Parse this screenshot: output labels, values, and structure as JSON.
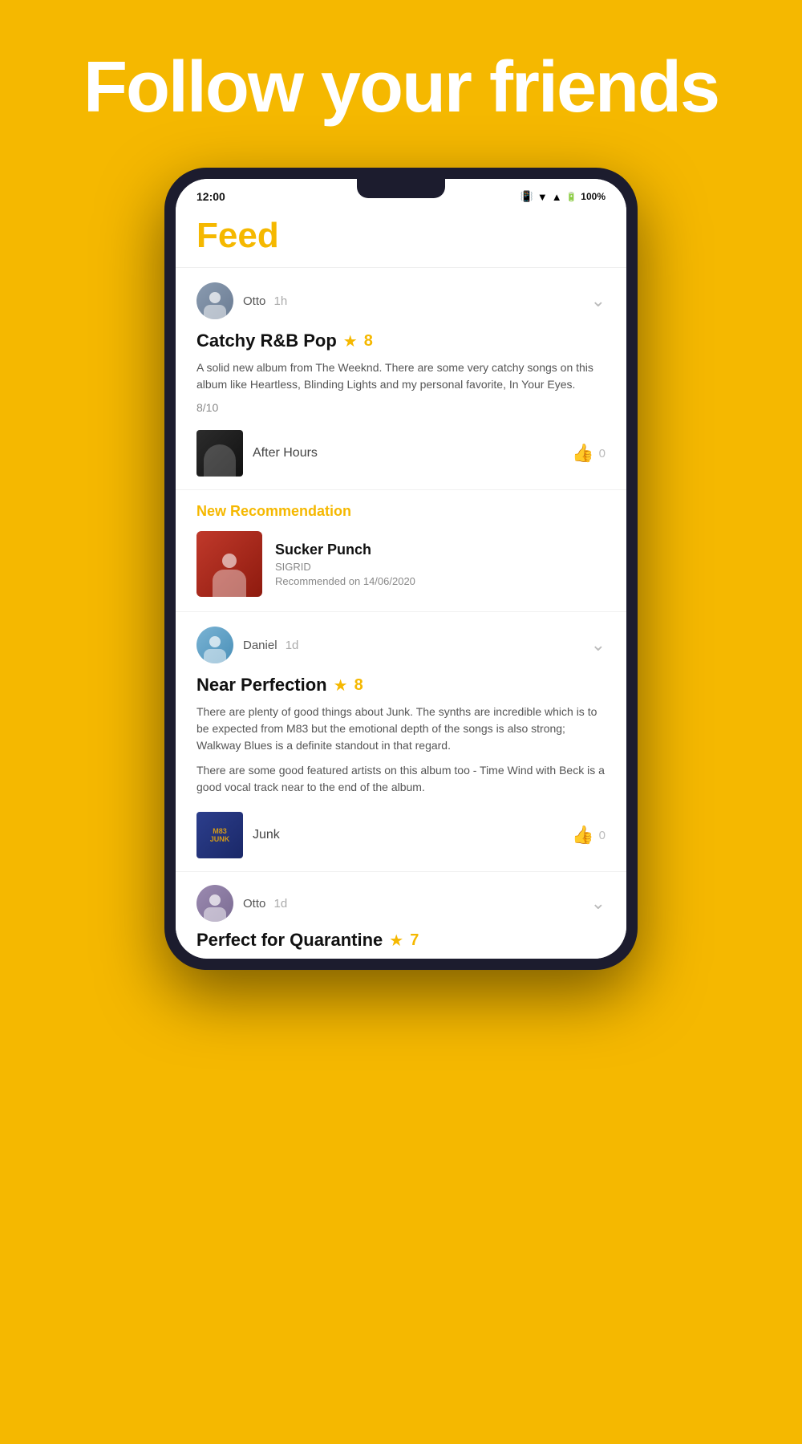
{
  "hero": {
    "title": "Follow your friends"
  },
  "status_bar": {
    "time": "12:00",
    "battery": "100%"
  },
  "app": {
    "title": "Feed"
  },
  "feed_items": [
    {
      "id": "review-1",
      "user": "Otto",
      "time_ago": "1h",
      "review_title": "Catchy R&B Pop",
      "score": "8",
      "review_text": "A solid new album from The Weeknd. There are some very catchy songs on this album like Heartless, Blinding Lights and my personal favorite, In Your Eyes.",
      "rating": "8/10",
      "album_name": "After Hours",
      "likes": "0"
    }
  ],
  "new_recommendation": {
    "label": "New Recommendation",
    "title": "Sucker Punch",
    "artist": "SIGRID",
    "date": "Recommended on 14/06/2020"
  },
  "feed_items_2": [
    {
      "id": "review-2",
      "user": "Daniel",
      "time_ago": "1d",
      "review_title": "Near Perfection",
      "score": "8",
      "review_text": "There are plenty of good things about Junk. The synths are incredible which is to be expected from M83 but the emotional depth of the songs is also strong; Walkway Blues is a definite standout in that regard.",
      "review_text_2": "There are some good featured artists on this album too - Time Wind with Beck is a good vocal track near to the end of the album.",
      "album_name": "Junk",
      "likes": "0"
    }
  ],
  "partial_item": {
    "user": "Otto",
    "time_ago": "1d",
    "review_title": "Perfect for Quarantine",
    "score": "7"
  },
  "icons": {
    "chevron_down": "⌄",
    "star": "★",
    "thumb_up": "👍"
  }
}
